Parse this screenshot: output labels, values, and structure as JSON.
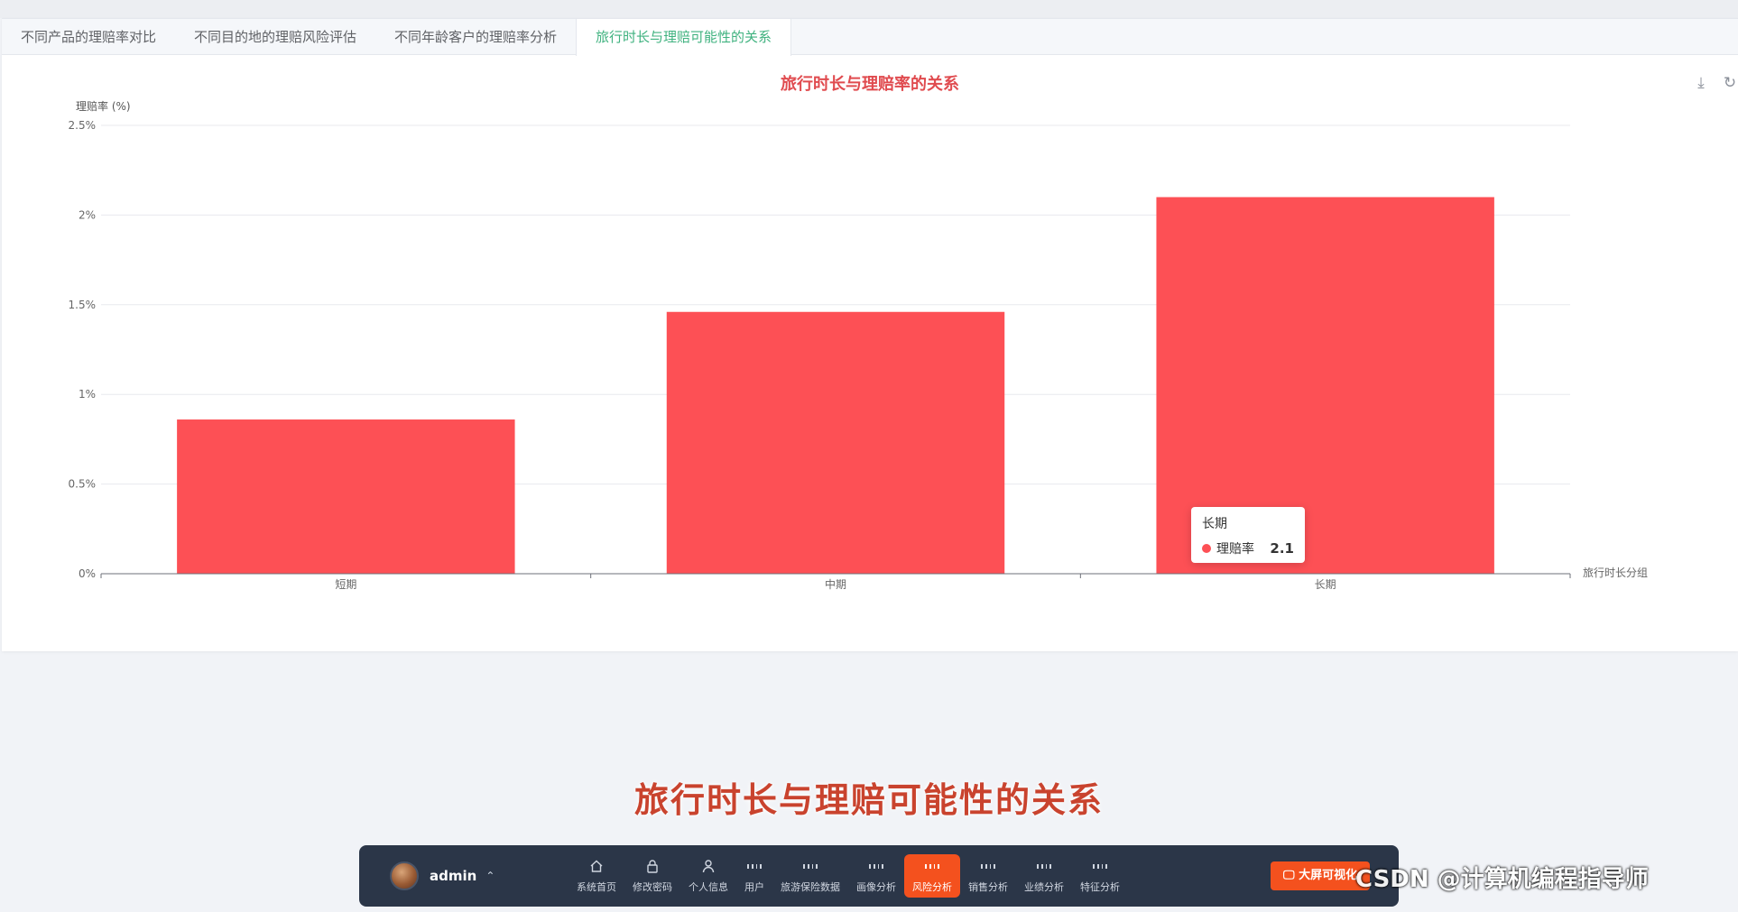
{
  "tabs": [
    {
      "label": "不同产品的理赔率对比",
      "active": false
    },
    {
      "label": "不同目的地的理赔风险评估",
      "active": false
    },
    {
      "label": "不同年龄客户的理赔率分析",
      "active": false
    },
    {
      "label": "旅行时长与理赔可能性的关系",
      "active": true
    }
  ],
  "toolbar": {
    "download_icon": "download-icon",
    "refresh_icon": "refresh-icon"
  },
  "chart_data": {
    "type": "bar",
    "title": "旅行时长与理赔率的关系",
    "ylabel": "理赔率 (%)",
    "xlabel": "旅行时长分组",
    "categories": [
      "短期",
      "中期",
      "长期"
    ],
    "series": [
      {
        "name": "理赔率",
        "values": [
          0.86,
          1.46,
          2.1
        ],
        "color": "#fd5055"
      }
    ],
    "ylim": [
      0,
      2.5
    ],
    "yticks": [
      0,
      0.5,
      1,
      1.5,
      2,
      2.5
    ],
    "ytick_labels": [
      "0%",
      "0.5%",
      "1%",
      "1.5%",
      "2%",
      "2.5%"
    ],
    "grid": true
  },
  "tooltip": {
    "title": "长期",
    "series": "理赔率",
    "value": "2.1"
  },
  "caption": "旅行时长与理赔可能性的关系",
  "dock": {
    "username": "admin",
    "nav": [
      {
        "label": "系统首页",
        "icon": "home-icon",
        "active": false
      },
      {
        "label": "修改密码",
        "icon": "lock-icon",
        "active": false
      },
      {
        "label": "个人信息",
        "icon": "user-icon",
        "active": false
      },
      {
        "label": "用户",
        "icon": "grid-icon",
        "active": false
      },
      {
        "label": "旅游保险数据",
        "icon": "grid-icon",
        "active": false
      },
      {
        "label": "画像分析",
        "icon": "grid-icon",
        "active": false
      },
      {
        "label": "风险分析",
        "icon": "grid-icon",
        "active": true
      },
      {
        "label": "销售分析",
        "icon": "grid-icon",
        "active": false
      },
      {
        "label": "业绩分析",
        "icon": "grid-icon",
        "active": false
      },
      {
        "label": "特征分析",
        "icon": "grid-icon",
        "active": false
      }
    ],
    "big_button": "大屏可视化"
  },
  "watermark": "CSDN @计算机编程指导师"
}
